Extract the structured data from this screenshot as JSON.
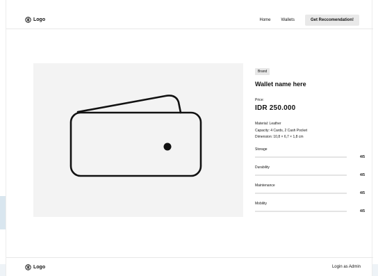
{
  "header": {
    "logo_text": "Logo",
    "nav": {
      "home": "Home",
      "wallets": "Wallets",
      "cta": "Get Reccomendation!"
    }
  },
  "product": {
    "brand": "Brand",
    "name": "Wallet name here",
    "price_label": "Price:",
    "price": "IDR 250.000",
    "specs": {
      "material": "Material: Leather",
      "capacity": "Capacity: 4 Cards, 2 Cash Pocket",
      "dimension": "Dimension: 10,8 × 6,7 × 1,8 cm"
    },
    "image_icon": "wallet-icon",
    "ratings": [
      {
        "label": "Storage",
        "value": "4/5",
        "score": 0.8
      },
      {
        "label": "Durability",
        "value": "4/5",
        "score": 0.8
      },
      {
        "label": "Maintenance",
        "value": "4/5",
        "score": 0.8
      },
      {
        "label": "Mobility",
        "value": "4/5",
        "score": 0.8
      }
    ]
  },
  "footer": {
    "logo_text": "Logo",
    "login": "Login as Admin"
  },
  "colors": {
    "image_bg": "#f3f3f3",
    "tag_bg": "#e7e7e7",
    "button_bg": "#e9e9e9",
    "track": "#e4e4e4"
  }
}
